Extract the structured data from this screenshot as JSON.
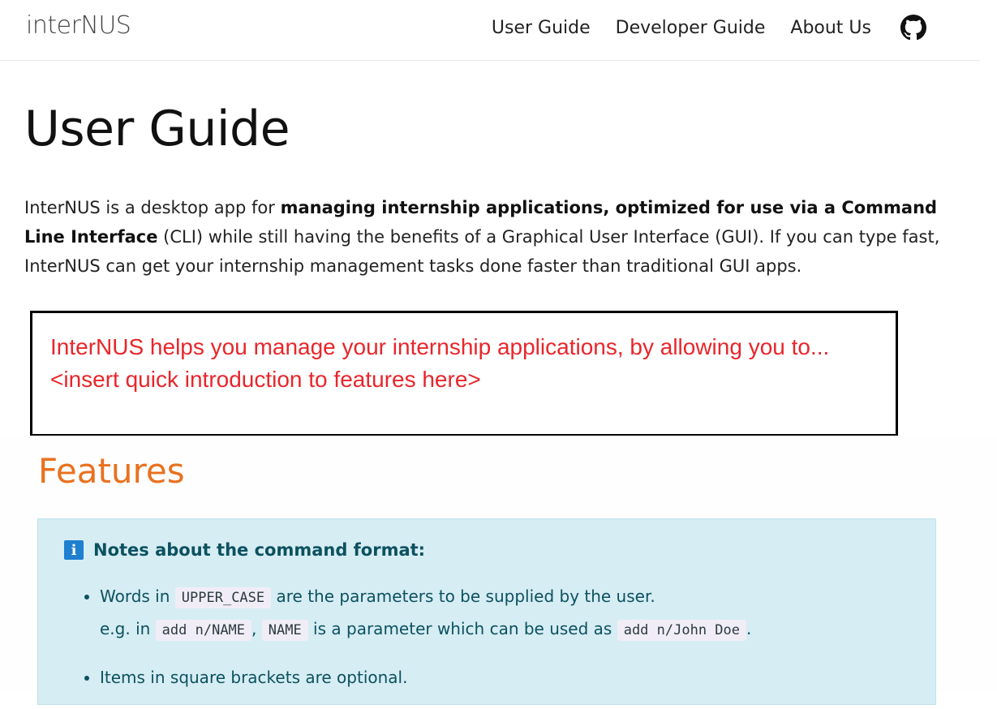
{
  "navbar": {
    "brand": "interNUS",
    "links": [
      "User Guide",
      "Developer Guide",
      "About Us"
    ],
    "icon": "github-icon"
  },
  "page": {
    "title": "User Guide",
    "intro": {
      "p1": "InterNUS is a desktop app for ",
      "bold": "managing internship applications, optimized for use via a Command Line Interface",
      "p2": " (CLI) while still having the benefits of a Graphical User Interface (GUI). If you can type fast, InterNUS can get your internship management tasks done faster than traditional GUI apps."
    },
    "note": "InterNUS helps you manage your internship applications, by allowing you to... <insert quick introduction to features here>"
  },
  "features": {
    "heading": "Features",
    "alert_title": "Notes about the command format:",
    "item1": {
      "t1": "Words in ",
      "c1": "UPPER_CASE",
      "t2": " are the parameters to be supplied by the user.",
      "t3": "e.g. in ",
      "c2": "add n/NAME",
      "t4": ", ",
      "c3": "NAME",
      "t5": " is a parameter which can be used as ",
      "c4": "add n/John Doe",
      "t6": "."
    },
    "item2": "Items in square brackets are optional."
  },
  "colors": {
    "accent_orange": "#e8711f",
    "note_red": "#e8262b",
    "alert_bg": "#d6edf3",
    "alert_text": "#0c5160"
  }
}
